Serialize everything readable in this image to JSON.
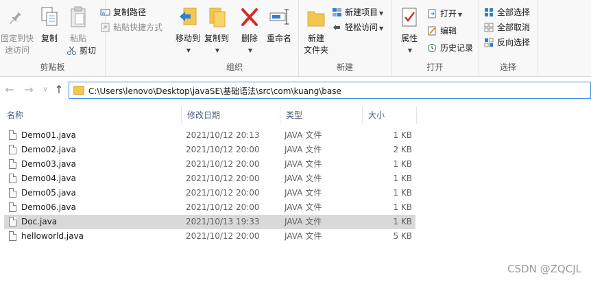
{
  "ribbon": {
    "clipboard": {
      "pin_label_1": "固定到快",
      "pin_label_2": "速访问",
      "copy": "复制",
      "paste": "粘贴",
      "copy_path": "复制路径",
      "paste_shortcut": "粘贴快捷方式",
      "cut": "剪切",
      "group": "剪贴板"
    },
    "organize": {
      "move_to": "移动到",
      "copy_to": "复制到",
      "delete": "删除",
      "rename": "重命名",
      "group": "组织"
    },
    "new": {
      "new_folder_1": "新建",
      "new_folder_2": "文件夹",
      "new_item": "新建项目",
      "easy_access": "轻松访问",
      "group": "新建"
    },
    "open": {
      "properties": "属性",
      "open": "打开",
      "edit": "编辑",
      "history": "历史记录",
      "group": "打开"
    },
    "select": {
      "select_all": "全部选择",
      "select_none": "全部取消",
      "invert": "反向选择",
      "group": "选择"
    }
  },
  "address": {
    "path": "C:\\Users\\lenovo\\Desktop\\javaSE\\基础语法\\src\\com\\kuang\\base"
  },
  "columns": {
    "name": "名称",
    "date": "修改日期",
    "type": "类型",
    "size": "大小"
  },
  "files": [
    {
      "name": "Demo01.java",
      "date": "2021/10/12 20:13",
      "type": "JAVA 文件",
      "size": "1 KB"
    },
    {
      "name": "Demo02.java",
      "date": "2021/10/12 20:00",
      "type": "JAVA 文件",
      "size": "2 KB"
    },
    {
      "name": "Demo03.java",
      "date": "2021/10/12 20:00",
      "type": "JAVA 文件",
      "size": "1 KB"
    },
    {
      "name": "Demo04.java",
      "date": "2021/10/12 20:00",
      "type": "JAVA 文件",
      "size": "1 KB"
    },
    {
      "name": "Demo05.java",
      "date": "2021/10/12 20:00",
      "type": "JAVA 文件",
      "size": "1 KB"
    },
    {
      "name": "Demo06.java",
      "date": "2021/10/12 20:00",
      "type": "JAVA 文件",
      "size": "1 KB"
    },
    {
      "name": "Doc.java",
      "date": "2021/10/13 19:33",
      "type": "JAVA 文件",
      "size": "1 KB"
    },
    {
      "name": "helloworld.java",
      "date": "2021/10/12 20:00",
      "type": "JAVA 文件",
      "size": "5 KB"
    }
  ],
  "selected_file": "Doc.java",
  "watermark": "CSDN @ZQCJL",
  "colors": {
    "accent": "#3c8ce6",
    "selection": "#d9d9d9",
    "folder": "#f3c64f",
    "delete_red": "#d42b2b"
  }
}
